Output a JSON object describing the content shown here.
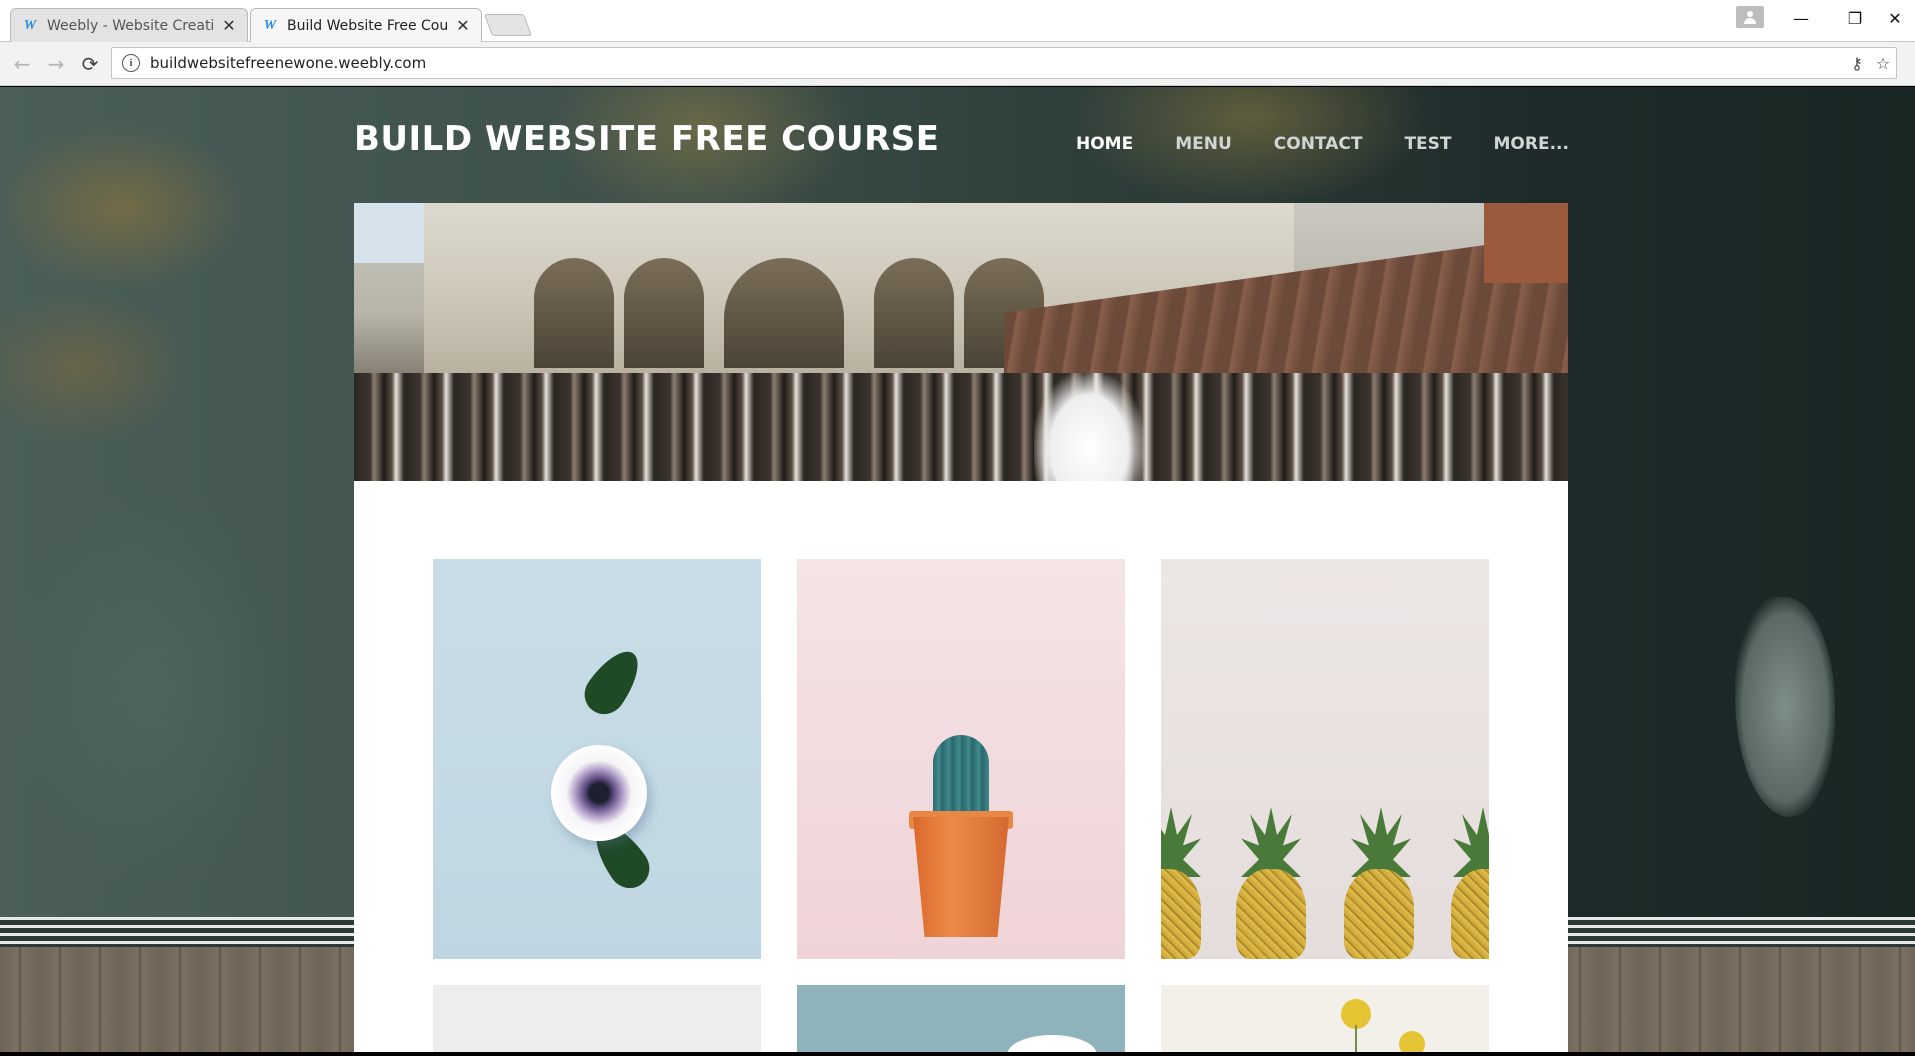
{
  "browser": {
    "tabs": [
      {
        "title": "Weebly - Website Creatic",
        "favicon": "W",
        "active": false
      },
      {
        "title": "Build Website Free Cours",
        "favicon": "W",
        "active": true
      }
    ],
    "close_glyph": "✕",
    "url": "buildwebsitefreenewone.weebly.com",
    "info_glyph": "i",
    "icons": {
      "back": "←",
      "forward": "→",
      "reload": "⟳",
      "key": "⚷",
      "star": "☆",
      "profile": "👤",
      "minimize": "—",
      "restore": "❐",
      "close": "✕"
    }
  },
  "site": {
    "title": "BUILD WEBSITE FREE COURSE",
    "nav": [
      "HOME",
      "MENU",
      "CONTACT",
      "TEST",
      "MORE..."
    ]
  },
  "colors": {
    "accent_nav_active": "#ffffff",
    "nav_inactive": "#cfd6d4",
    "weebly_blue": "#2b8ad8"
  },
  "gallery": [
    {
      "subject": "white anemone flower on light blue"
    },
    {
      "subject": "cactus in orange pot on pink"
    },
    {
      "subject": "row of pineapples on beige"
    },
    {
      "subject": "light grey image (cropped)"
    },
    {
      "subject": "teal image with white flower (cropped)"
    },
    {
      "subject": "yellow craspedia flowers (cropped)"
    }
  ]
}
